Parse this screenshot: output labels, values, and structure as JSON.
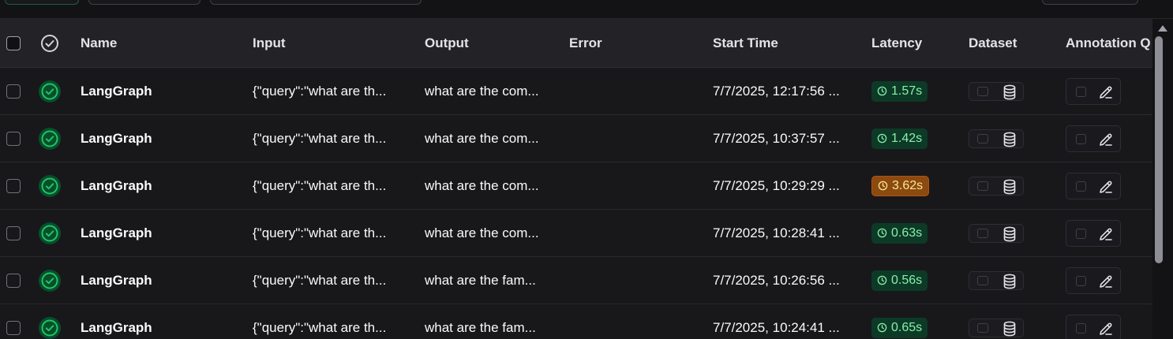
{
  "header": {
    "name": "Name",
    "input": "Input",
    "output": "Output",
    "error": "Error",
    "start_time": "Start Time",
    "latency": "Latency",
    "dataset": "Dataset",
    "annotation": "Annotation Q"
  },
  "colors": {
    "success": "#22c55e",
    "latency_ok_bg": "#0d3a26",
    "latency_warn_bg": "#8a4a12"
  },
  "rows": [
    {
      "status": "success",
      "name": "LangGraph",
      "input": "{\"query\":\"what are th...",
      "output": "what are the com...",
      "error": "",
      "start_time": "7/7/2025, 12:17:56 ...",
      "latency": "1.57s",
      "latency_level": "ok"
    },
    {
      "status": "success",
      "name": "LangGraph",
      "input": "{\"query\":\"what are th...",
      "output": "what are the com...",
      "error": "",
      "start_time": "7/7/2025, 10:37:57 ...",
      "latency": "1.42s",
      "latency_level": "ok"
    },
    {
      "status": "success",
      "name": "LangGraph",
      "input": "{\"query\":\"what are th...",
      "output": "what are the com...",
      "error": "",
      "start_time": "7/7/2025, 10:29:29 ...",
      "latency": "3.62s",
      "latency_level": "warn"
    },
    {
      "status": "success",
      "name": "LangGraph",
      "input": "{\"query\":\"what are th...",
      "output": "what are the com...",
      "error": "",
      "start_time": "7/7/2025, 10:28:41 ...",
      "latency": "0.63s",
      "latency_level": "ok"
    },
    {
      "status": "success",
      "name": "LangGraph",
      "input": "{\"query\":\"what are th...",
      "output": "what are the fam...",
      "error": "",
      "start_time": "7/7/2025, 10:26:56 ...",
      "latency": "0.56s",
      "latency_level": "ok"
    },
    {
      "status": "success",
      "name": "LangGraph",
      "input": "{\"query\":\"what are th...",
      "output": "what are the fam...",
      "error": "",
      "start_time": "7/7/2025, 10:24:41 ...",
      "latency": "0.65s",
      "latency_level": "ok"
    }
  ]
}
